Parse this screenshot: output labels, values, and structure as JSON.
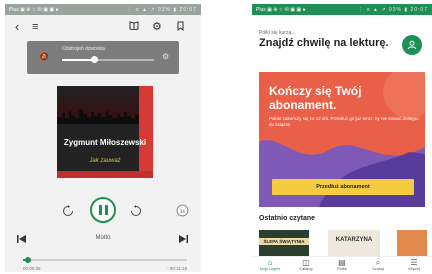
{
  "player": {
    "status_left": "Plus ▣ ⊕ ☆ ✉ ▣ ▣ ●",
    "status_right": "⋮ ≡ ▲ ↗ 93% ▮ 20:07",
    "volume_label": "Odstrojeń dzwonka",
    "volume_level": 0.35,
    "cover_author": "Zygmunt Miłoszewski",
    "cover_title": "Jak zauważ",
    "chapter_title": "Motto",
    "progress": 0.03,
    "time_elapsed": "00:00:35",
    "time_remaining": "- 00:11:18",
    "back_label": "15",
    "fwd_label": "15",
    "speed_label": "1x"
  },
  "home": {
    "status_left": "Plus ▣ ⊕ ☆ ✉ ▣ ▣ ●",
    "status_right": "⋮ ≡ ▲ ↗ 93% ▮ 20:07",
    "greeting_small": "Pólki się kurzą...",
    "greeting_big": "Znajdź chwilę na lekturę.",
    "promo_title": "Kończy się Twój abonament.",
    "promo_text": "Pakiet zakończy się za 12 dni. Przedłuż go już teraz, by nie stracić dostępu do książek.",
    "promo_button": "Przedłuż abonament",
    "section_title": "Ostatnio czytane",
    "books": [
      "ŚLEPA ŚWIĄTYNIA",
      "KATARZYNA",
      ""
    ],
    "nav": [
      {
        "label": "Moja Legimi",
        "icon": "home-icon"
      },
      {
        "label": "Katalog",
        "icon": "catalog-icon"
      },
      {
        "label": "Półka",
        "icon": "shelf-icon"
      },
      {
        "label": "Szukaj",
        "icon": "search-icon"
      },
      {
        "label": "Więcej",
        "icon": "menu-icon"
      }
    ]
  },
  "colors": {
    "accent_green": "#1e8f55",
    "promo_red": "#e95f47",
    "promo_button": "#f5cc3f"
  }
}
